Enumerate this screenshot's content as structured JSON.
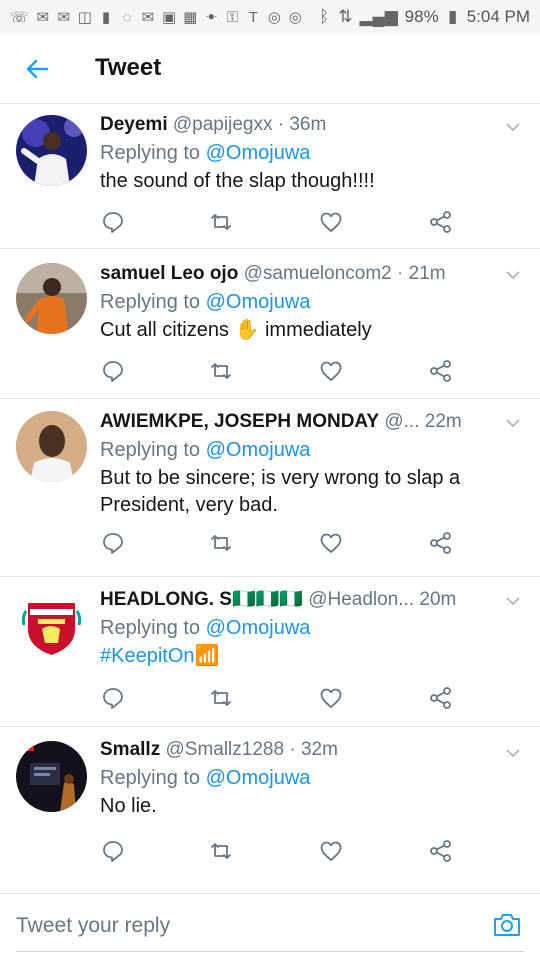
{
  "status_bar": {
    "battery": "98%",
    "time": "5:04 PM"
  },
  "header": {
    "title": "Tweet"
  },
  "tweets": [
    {
      "name": "Deyemi",
      "handle": "@papijegxx",
      "time": "· 36m",
      "replying_prefix": "Replying to",
      "replying_to": "@Omojuwa",
      "text": "the sound of the slap though!!!!"
    },
    {
      "name": "samuel Leo ojo",
      "handle": "@samueloncom2",
      "time": "· 21m",
      "replying_prefix": "Replying to",
      "replying_to": "@Omojuwa",
      "text_before": "Cut all citizens",
      "emoji": "✋",
      "text_after": "immediately"
    },
    {
      "name": "AWIEMKPE, JOSEPH MONDAY",
      "handle": "@...",
      "time": "22m",
      "replying_prefix": "Replying to",
      "replying_to": "@Omojuwa",
      "text_line1": "But to be sincere; is very wrong to slap a",
      "text_line2": "President, very bad."
    },
    {
      "name": "HEADLONG. S",
      "flags": "🇳🇬🇳🇬🇳🇬",
      "handle": "@Headlon...",
      "time": "20m",
      "replying_prefix": "Replying to",
      "replying_to": "@Omojuwa",
      "hashtag": "#KeepitOn",
      "emoji": "📶"
    },
    {
      "name": "Smallz",
      "handle": "@Smallz1288",
      "time": "· 32m",
      "replying_prefix": "Replying to",
      "replying_to": "@Omojuwa",
      "text": "No lie."
    }
  ],
  "reply_bar": {
    "placeholder": "Tweet your reply"
  },
  "colors": {
    "accent": "#1da1f2",
    "link": "#1b95e0",
    "secondary_text": "#657786",
    "divider": "#e1e8ed"
  }
}
